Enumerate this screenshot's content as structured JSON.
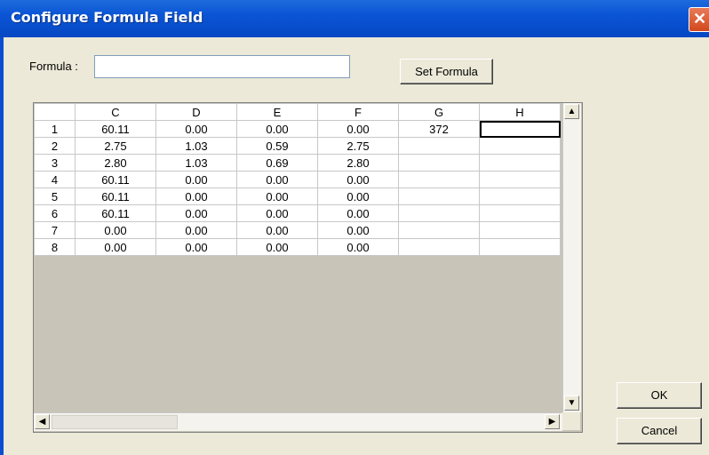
{
  "window": {
    "title": "Configure Formula Field",
    "close_glyph": "✕"
  },
  "formula": {
    "label": "Formula :",
    "value": "",
    "set_button": "Set Formula"
  },
  "grid": {
    "columns": [
      "",
      "C",
      "D",
      "E",
      "F",
      "G",
      "H"
    ],
    "rows": [
      [
        "1",
        "60.11",
        "0.00",
        "0.00",
        "0.00",
        "372",
        ""
      ],
      [
        "2",
        "2.75",
        "1.03",
        "0.59",
        "2.75",
        "",
        ""
      ],
      [
        "3",
        "2.80",
        "1.03",
        "0.69",
        "2.80",
        "",
        ""
      ],
      [
        "4",
        "60.11",
        "0.00",
        "0.00",
        "0.00",
        "",
        ""
      ],
      [
        "5",
        "60.11",
        "0.00",
        "0.00",
        "0.00",
        "",
        ""
      ],
      [
        "6",
        "60.11",
        "0.00",
        "0.00",
        "0.00",
        "",
        ""
      ],
      [
        "7",
        "0.00",
        "0.00",
        "0.00",
        "0.00",
        "",
        ""
      ],
      [
        "8",
        "0.00",
        "0.00",
        "0.00",
        "0.00",
        "",
        ""
      ]
    ],
    "scroll_up": "▲",
    "scroll_down": "▼",
    "scroll_left": "◀",
    "scroll_right": "▶"
  },
  "buttons": {
    "ok": "OK",
    "cancel": "Cancel"
  }
}
